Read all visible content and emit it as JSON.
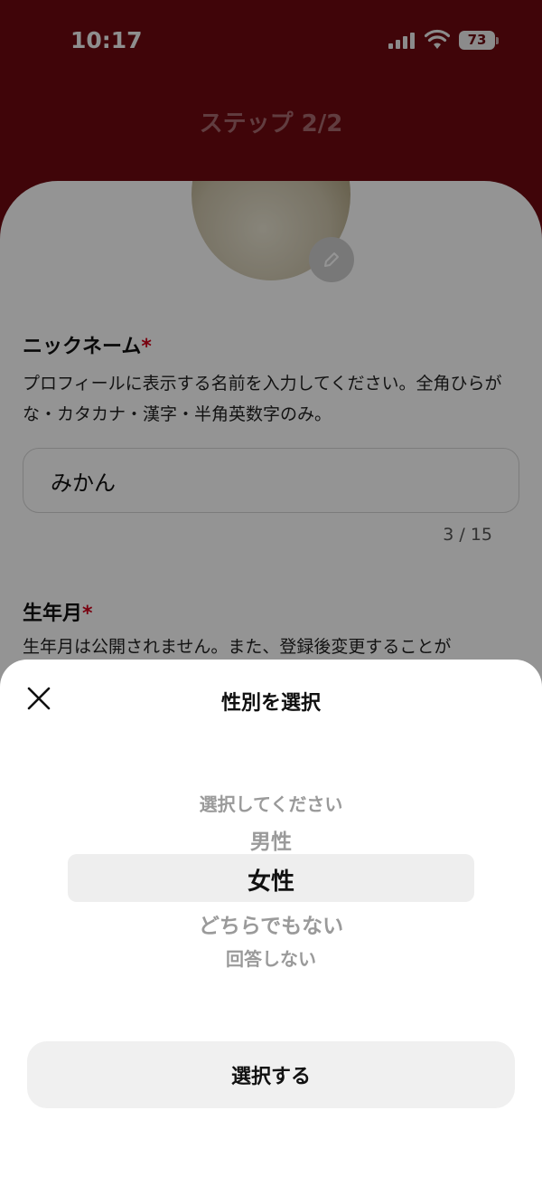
{
  "status_bar": {
    "time": "10:17",
    "battery": "73"
  },
  "header": {
    "title": "ステップ 2/2"
  },
  "form": {
    "nickname": {
      "label": "ニックネーム",
      "required_mark": "*",
      "description": "プロフィールに表示する名前を入力してください。全角ひらがな・カタカナ・漢字・半角英数字のみ。",
      "value": "みかん",
      "counter": "3 / 15"
    },
    "birth": {
      "label": "生年月",
      "required_mark": "*",
      "description": "生年月は公開されません。また、登録後変更することが"
    }
  },
  "sheet": {
    "title": "性別を選択",
    "close_icon": "close-icon",
    "options": [
      "選択してください",
      "男性",
      "女性",
      "どちらでもない",
      "回答しない"
    ],
    "selected_index": 2,
    "button_label": "選択する"
  },
  "colors": {
    "header_bg": "#6f0a10",
    "required": "#d0021b"
  }
}
